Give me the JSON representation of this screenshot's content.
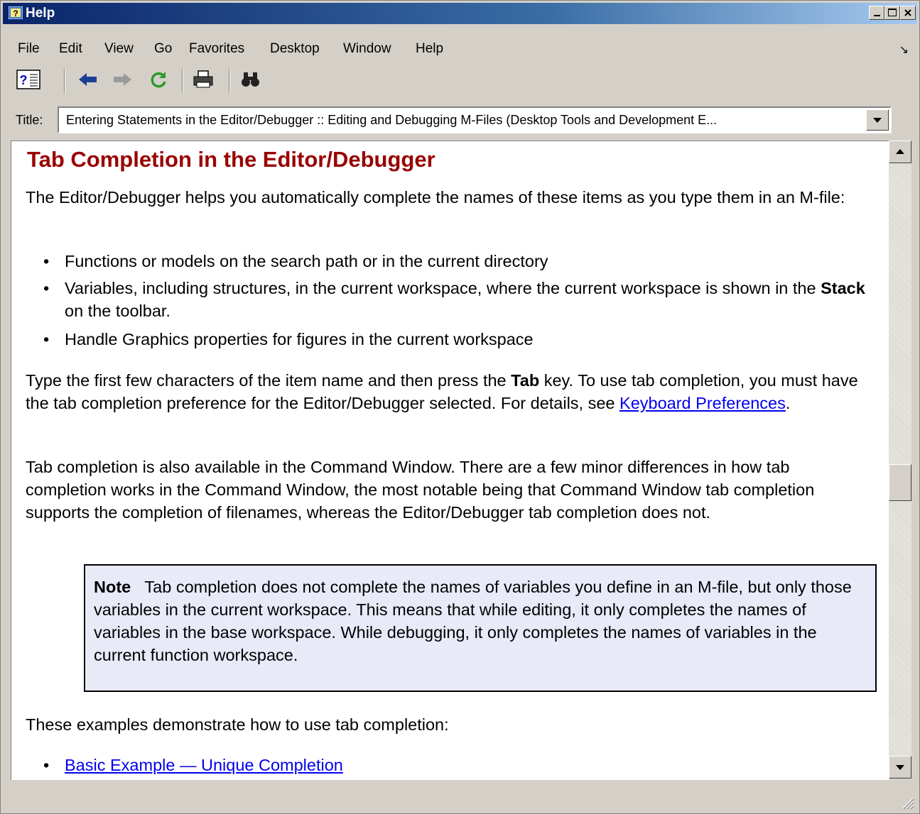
{
  "window": {
    "title": "Help"
  },
  "menu": [
    "File",
    "Edit",
    "View",
    "Go",
    "Favorites",
    "Desktop",
    "Window",
    "Help"
  ],
  "toolbar": {
    "icons": [
      "help-navigator-icon",
      "back-icon",
      "forward-icon",
      "refresh-icon",
      "print-icon",
      "find-icon"
    ]
  },
  "titlebox": {
    "label": "Title:",
    "value": "Entering Statements in the Editor/Debugger :: Editing and Debugging M-Files (Desktop Tools and Development E..."
  },
  "doc": {
    "heading": "Tab Completion in the Editor/Debugger",
    "intro": "The Editor/Debugger helps you automatically complete the names of these items as you type them in an M-file:",
    "items": [
      {
        "text": "Functions or models on the search path or in the current directory"
      },
      {
        "text_before": "Variables, including structures, in the current workspace, where the current workspace is shown in the ",
        "bold": "Stack",
        "text_after": " on the toolbar."
      },
      {
        "text": "Handle Graphics properties for figures in the current workspace"
      }
    ],
    "para2": {
      "before": "Type the first few characters of the item name and then press the ",
      "bold": "Tab",
      "after": " key. To use tab completion, you must have the tab completion preference for the Editor/Debugger selected. For details, see ",
      "link": "Keyboard Preferences",
      "end": "."
    },
    "para3": "Tab completion is also available in the Command Window. There are a few minor differences in how tab completion works in the Command Window, the most notable being that Command Window tab completion supports the completion of filenames, whereas the Editor/Debugger tab completion does not.",
    "note": {
      "label": "Note",
      "text": "Tab completion does not complete the names of variables you define in an M-file, but only those variables in the current workspace. This means that while editing, it only completes the names of variables in the base workspace. While debugging, it only completes the names of variables in the current function workspace."
    },
    "para4": "These examples demonstrate how to use tab completion:",
    "example_link": "Basic Example — Unique Completion"
  },
  "colors": {
    "heading": "#990000",
    "link": "#0000ee",
    "note_bg": "#e8eaf8"
  }
}
